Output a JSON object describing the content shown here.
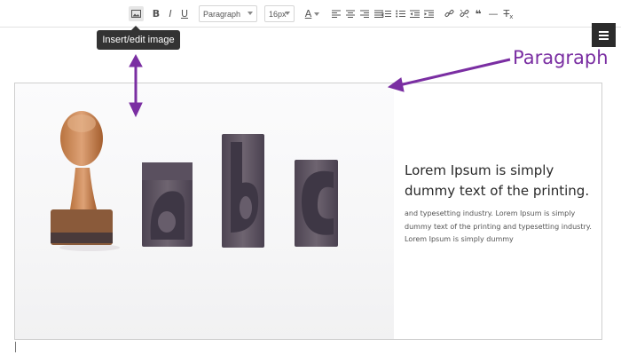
{
  "toolbar": {
    "image_button": "Insert/edit image",
    "bold_label": "B",
    "italic_label": "I",
    "underline_label": "U",
    "format_select": "Paragraph",
    "fontsize_select": "16px",
    "text_color_label": "A",
    "blockquote_label": "❝",
    "hr_label": "—",
    "clear_format_label": "T",
    "clear_format_sub": "x"
  },
  "tooltip": {
    "text": "Insert/edit image"
  },
  "annotation": {
    "label": "Paragraph",
    "color": "#7a2ea2"
  },
  "content": {
    "heading": "Lorem Ipsum is simply dummy text of the printing.",
    "body": "and typesetting industry. Lorem Ipsum is simply dummy text of the printing and typesetting industry. Lorem Ipsum is simply dummy"
  },
  "image": {
    "description_icons": [
      "stamp-icon",
      "letter-a-block-icon",
      "letter-b-block-icon",
      "letter-c-block-icon"
    ],
    "block_letters": [
      "a",
      "b",
      "c"
    ]
  },
  "colors": {
    "accent": "#7a2ea2",
    "tooltip_bg": "#333333",
    "menu_bg": "#2b2b2b"
  }
}
